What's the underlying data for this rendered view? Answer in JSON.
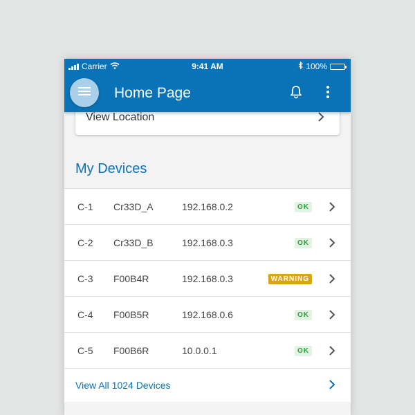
{
  "status_bar": {
    "carrier": "Carrier",
    "time": "9:41 AM",
    "battery": "100%"
  },
  "header": {
    "title": "Home Page"
  },
  "location_card": {
    "label": "View Location"
  },
  "devices_section": {
    "title": "My Devices",
    "devices": [
      {
        "id": "C-1",
        "name": "Cr33D_A",
        "ip": "192.168.0.2",
        "status": "OK"
      },
      {
        "id": "C-2",
        "name": "Cr33D_B",
        "ip": "192.168.0.3",
        "status": "OK"
      },
      {
        "id": "C-3",
        "name": "F00B4R",
        "ip": "192.168.0.3",
        "status": "WARNING"
      },
      {
        "id": "C-4",
        "name": "F00B5R",
        "ip": "192.168.0.6",
        "status": "OK"
      },
      {
        "id": "C-5",
        "name": "F00B6R",
        "ip": "10.0.0.1",
        "status": "OK"
      }
    ],
    "view_all_label": "View All 1024 Devices"
  },
  "colors": {
    "primary": "#0a72b7",
    "ok": "#2f9e3a",
    "warning": "#dba316"
  }
}
